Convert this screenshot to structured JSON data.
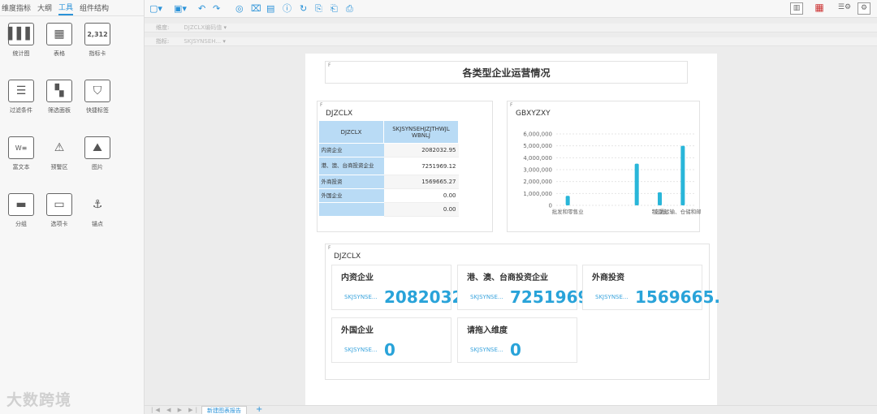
{
  "left_panel": {
    "tabs": [
      "维度指标",
      "大纲",
      "工具",
      "组件结构"
    ],
    "active_tab": "工具",
    "tools": [
      {
        "label": "统计图",
        "icon": "bar-chart-icon"
      },
      {
        "label": "表格",
        "icon": "table-icon"
      },
      {
        "label": "指标卡",
        "icon": "kpi-card-icon",
        "text": "2,312"
      },
      {
        "label": "过滤条件",
        "icon": "filter-condition-icon"
      },
      {
        "label": "筛选面板",
        "icon": "filter-panel-icon"
      },
      {
        "label": "快捷标签",
        "icon": "bookmark-icon"
      },
      {
        "label": "富文本",
        "icon": "rich-text-icon",
        "text": "W\nRTF"
      },
      {
        "label": "预警区",
        "icon": "warning-icon"
      },
      {
        "label": "图片",
        "icon": "image-icon"
      },
      {
        "label": "分组",
        "icon": "group-icon"
      },
      {
        "label": "选项卡",
        "icon": "tab-card-icon"
      },
      {
        "label": "锚点",
        "icon": "anchor-icon"
      }
    ],
    "logo": "大数跨境"
  },
  "filters": [
    {
      "label": "维度:",
      "value": "DJZCLX编码值"
    },
    {
      "label": "指标:",
      "value": "SKJSYNSEH..."
    }
  ],
  "report": {
    "title": "各类型企业运营情况",
    "table": {
      "title": "DJZCLX",
      "headers": [
        "DJZCLX",
        "SKJSYNSEHJZJTHWJL WBNLJ"
      ],
      "rows": [
        {
          "name": "内资企业",
          "value": "2082032.95"
        },
        {
          "name": "港、澳、台商投资企业",
          "value": "7251969.12"
        },
        {
          "name": "外商投资",
          "value": "1569665.27"
        },
        {
          "name": "外国企业",
          "value": "0.00"
        },
        {
          "name": "",
          "value": "0.00"
        }
      ]
    },
    "chart_title": "GBXYZXY",
    "cards_title": "DJZCLX",
    "cards": [
      {
        "title": "内资企业",
        "label": "SKJSYNSE...",
        "value": "2082032."
      },
      {
        "title": "港、澳、台商投资企业",
        "label": "SKJSYNSE...",
        "value": "7251969."
      },
      {
        "title": "外商投资",
        "label": "SKJSYNSE...",
        "value": "1569665."
      },
      {
        "title": "外国企业",
        "label": "SKJSYNSE...",
        "value": "0"
      },
      {
        "title": "请拖入维度",
        "label": "SKJSYNSE...",
        "value": "0"
      }
    ]
  },
  "chart_data": {
    "type": "bar",
    "title": "GBXYZXY",
    "xlabel": "",
    "ylabel": "",
    "ylim": [
      0,
      6000000
    ],
    "yticks": [
      "0",
      "1,000,000",
      "2,000,000",
      "3,000,000",
      "4,000,000",
      "5,000,000",
      "6,000,000"
    ],
    "categories": [
      "批发和零售业",
      "",
      "",
      "",
      "制造业",
      "交通运输、仓储和邮政业"
    ],
    "values": [
      800000,
      0,
      0,
      3500000,
      1100000,
      5000000
    ],
    "color": "#29b6d9"
  },
  "bottom": {
    "tab_label": "新建图表报告",
    "add": "+",
    "nav": "|◀ ◀ ▶ ▶|"
  },
  "colors": {
    "accent": "#2a92d8",
    "kpi": "#29a3d9",
    "header_cell": "#b9dbf5"
  }
}
